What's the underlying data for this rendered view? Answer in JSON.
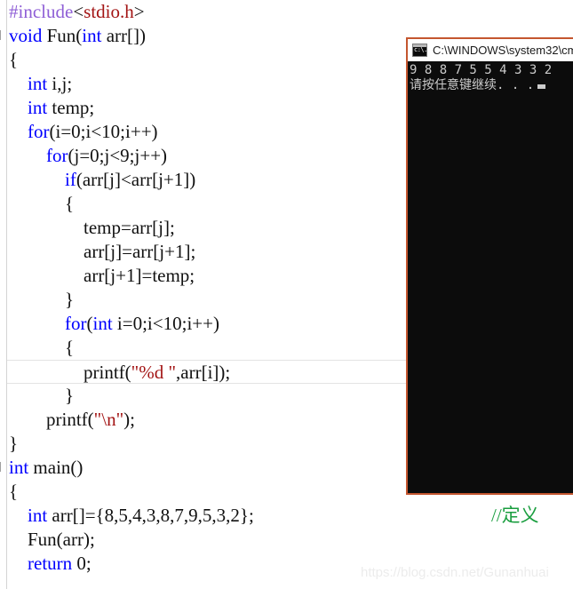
{
  "editor": {
    "name": "visual-studio-code-editor",
    "colors": {
      "keyword": "#0000ff",
      "preprocessor": "#8f5fd6",
      "string": "#a31515",
      "comment": "#1a9e3f",
      "plain": "#111111"
    },
    "lines": [
      {
        "indent": 0,
        "collapse": false,
        "tokens": [
          {
            "cls": "pre",
            "t": "#include"
          },
          {
            "cls": "pln",
            "t": "<"
          },
          {
            "cls": "hdr",
            "t": "stdio.h"
          },
          {
            "cls": "pln",
            "t": ">"
          }
        ]
      },
      {
        "indent": 0,
        "collapse": true,
        "tokens": [
          {
            "cls": "kw",
            "t": "void"
          },
          {
            "cls": "pln",
            "t": " Fun("
          },
          {
            "cls": "kw",
            "t": "int"
          },
          {
            "cls": "pln",
            "t": " arr[])"
          }
        ]
      },
      {
        "indent": 0,
        "collapse": false,
        "tokens": [
          {
            "cls": "pln",
            "t": "{"
          }
        ]
      },
      {
        "indent": 0,
        "collapse": false,
        "tokens": [
          {
            "cls": "kw",
            "t": "    int"
          },
          {
            "cls": "pln",
            "t": " i,j;"
          }
        ]
      },
      {
        "indent": 0,
        "collapse": false,
        "tokens": [
          {
            "cls": "kw",
            "t": "    int"
          },
          {
            "cls": "pln",
            "t": " temp;"
          }
        ]
      },
      {
        "indent": 0,
        "collapse": false,
        "tokens": [
          {
            "cls": "kw",
            "t": "    for"
          },
          {
            "cls": "pln",
            "t": "(i=0;i<10;i++)"
          }
        ]
      },
      {
        "indent": 0,
        "collapse": false,
        "tokens": [
          {
            "cls": "kw",
            "t": "        for"
          },
          {
            "cls": "pln",
            "t": "(j=0;j<9;j++)"
          }
        ]
      },
      {
        "indent": 0,
        "collapse": false,
        "tokens": [
          {
            "cls": "kw",
            "t": "            if"
          },
          {
            "cls": "pln",
            "t": "(arr[j]<arr[j+1])"
          }
        ]
      },
      {
        "indent": 0,
        "collapse": false,
        "tokens": [
          {
            "cls": "pln",
            "t": "            {"
          }
        ]
      },
      {
        "indent": 0,
        "collapse": false,
        "tokens": [
          {
            "cls": "pln",
            "t": "                temp=arr[j];"
          }
        ]
      },
      {
        "indent": 0,
        "collapse": false,
        "tokens": [
          {
            "cls": "pln",
            "t": "                arr[j]=arr[j+1];"
          }
        ]
      },
      {
        "indent": 0,
        "collapse": false,
        "tokens": [
          {
            "cls": "pln",
            "t": "                arr[j+1]=temp;"
          }
        ]
      },
      {
        "indent": 0,
        "collapse": false,
        "tokens": [
          {
            "cls": "pln",
            "t": "            }"
          }
        ]
      },
      {
        "indent": 0,
        "collapse": false,
        "tokens": [
          {
            "cls": "kw",
            "t": "            for"
          },
          {
            "cls": "pln",
            "t": "("
          },
          {
            "cls": "kw",
            "t": "int"
          },
          {
            "cls": "pln",
            "t": " i=0;i<10;i++)"
          }
        ]
      },
      {
        "indent": 0,
        "collapse": false,
        "tokens": [
          {
            "cls": "pln",
            "t": "            {"
          }
        ]
      },
      {
        "indent": 0,
        "collapse": false,
        "current": true,
        "tokens": [
          {
            "cls": "pln",
            "t": "                printf("
          },
          {
            "cls": "str",
            "t": "\"%d \""
          },
          {
            "cls": "pln",
            "t": ",arr[i]);"
          }
        ]
      },
      {
        "indent": 0,
        "collapse": false,
        "tokens": [
          {
            "cls": "pln",
            "t": "            }"
          }
        ]
      },
      {
        "indent": 0,
        "collapse": false,
        "tokens": [
          {
            "cls": "pln",
            "t": "        printf("
          },
          {
            "cls": "str",
            "t": "\"\\n\""
          },
          {
            "cls": "pln",
            "t": ");"
          }
        ]
      },
      {
        "indent": 0,
        "collapse": false,
        "tokens": [
          {
            "cls": "pln",
            "t": "}"
          }
        ]
      },
      {
        "indent": 0,
        "collapse": true,
        "tokens": [
          {
            "cls": "kw",
            "t": "int"
          },
          {
            "cls": "pln",
            "t": " main()"
          }
        ]
      },
      {
        "indent": 0,
        "collapse": false,
        "tokens": [
          {
            "cls": "pln",
            "t": "{"
          }
        ]
      },
      {
        "indent": 0,
        "collapse": false,
        "trail": "//定义",
        "tokens": [
          {
            "cls": "kw",
            "t": "    int"
          },
          {
            "cls": "pln",
            "t": " arr[]={8,5,4,3,8,7,9,5,3,2};"
          }
        ]
      },
      {
        "indent": 0,
        "collapse": false,
        "tokens": [
          {
            "cls": "pln",
            "t": "    Fun(arr);"
          }
        ]
      },
      {
        "indent": 0,
        "collapse": false,
        "tokens": [
          {
            "cls": "kw",
            "t": "    return"
          },
          {
            "cls": "pln",
            "t": " 0;"
          }
        ]
      }
    ]
  },
  "console": {
    "title": "C:\\WINDOWS\\system32\\cm",
    "icon": "cmd-icon",
    "output_lines": [
      "9 8 8 7 5 5 4 3 3 2",
      "请按任意键继续. . ."
    ]
  },
  "watermark": {
    "text": "https://blog.csdn.net/Gunanhuai"
  }
}
